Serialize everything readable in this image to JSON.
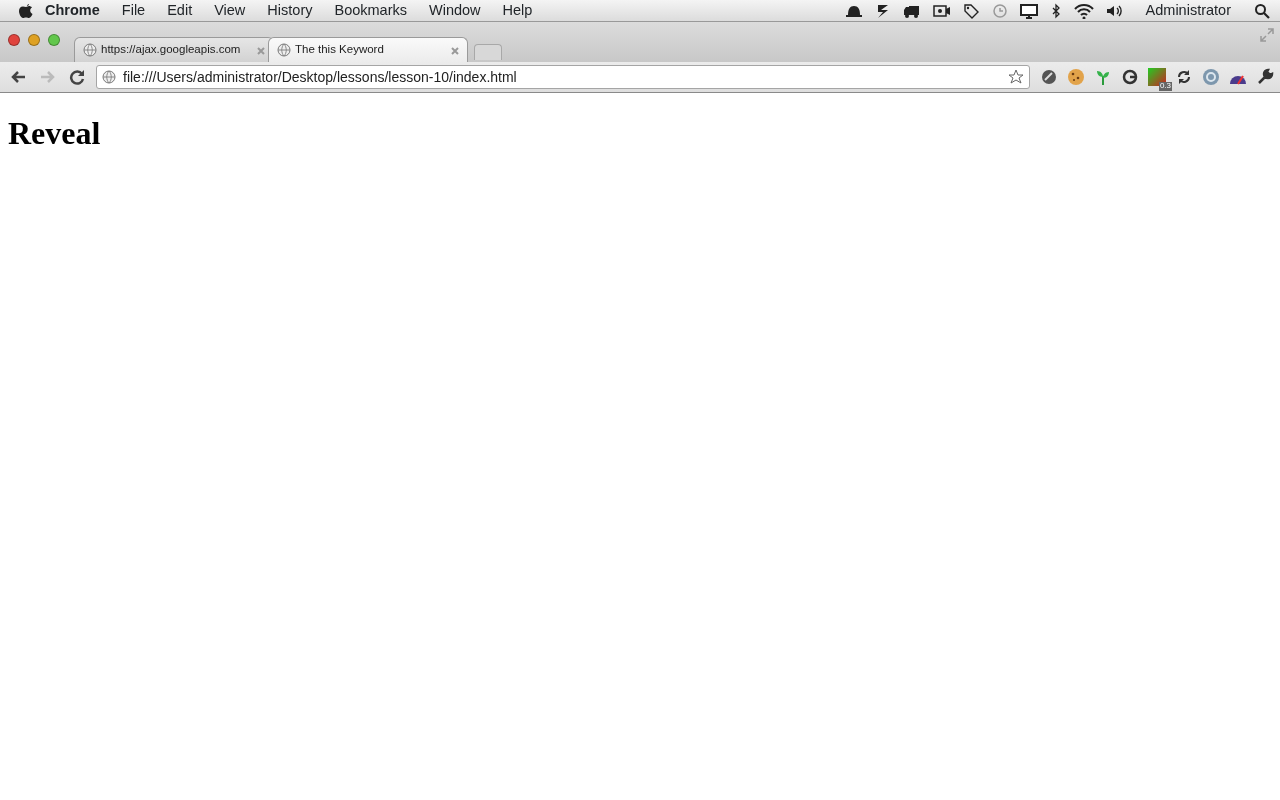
{
  "menu_bar": {
    "items": [
      {
        "label": "Chrome",
        "kind": "app"
      },
      {
        "label": "File",
        "kind": "menu"
      },
      {
        "label": "Edit",
        "kind": "menu"
      },
      {
        "label": "View",
        "kind": "menu"
      },
      {
        "label": "History",
        "kind": "menu"
      },
      {
        "label": "Bookmarks",
        "kind": "menu"
      },
      {
        "label": "Window",
        "kind": "menu"
      },
      {
        "label": "Help",
        "kind": "menu"
      }
    ],
    "user": "Administrator"
  },
  "tabs": [
    {
      "label": "https://ajax.googleapis.com",
      "selected": false
    },
    {
      "label": "The this Keyword",
      "selected": true
    }
  ],
  "address_bar": {
    "value": "file:///Users/administrator/Desktop/lessons/lesson-10/index.html"
  },
  "extension_badge": "0.3",
  "page": {
    "heading": "Reveal"
  }
}
